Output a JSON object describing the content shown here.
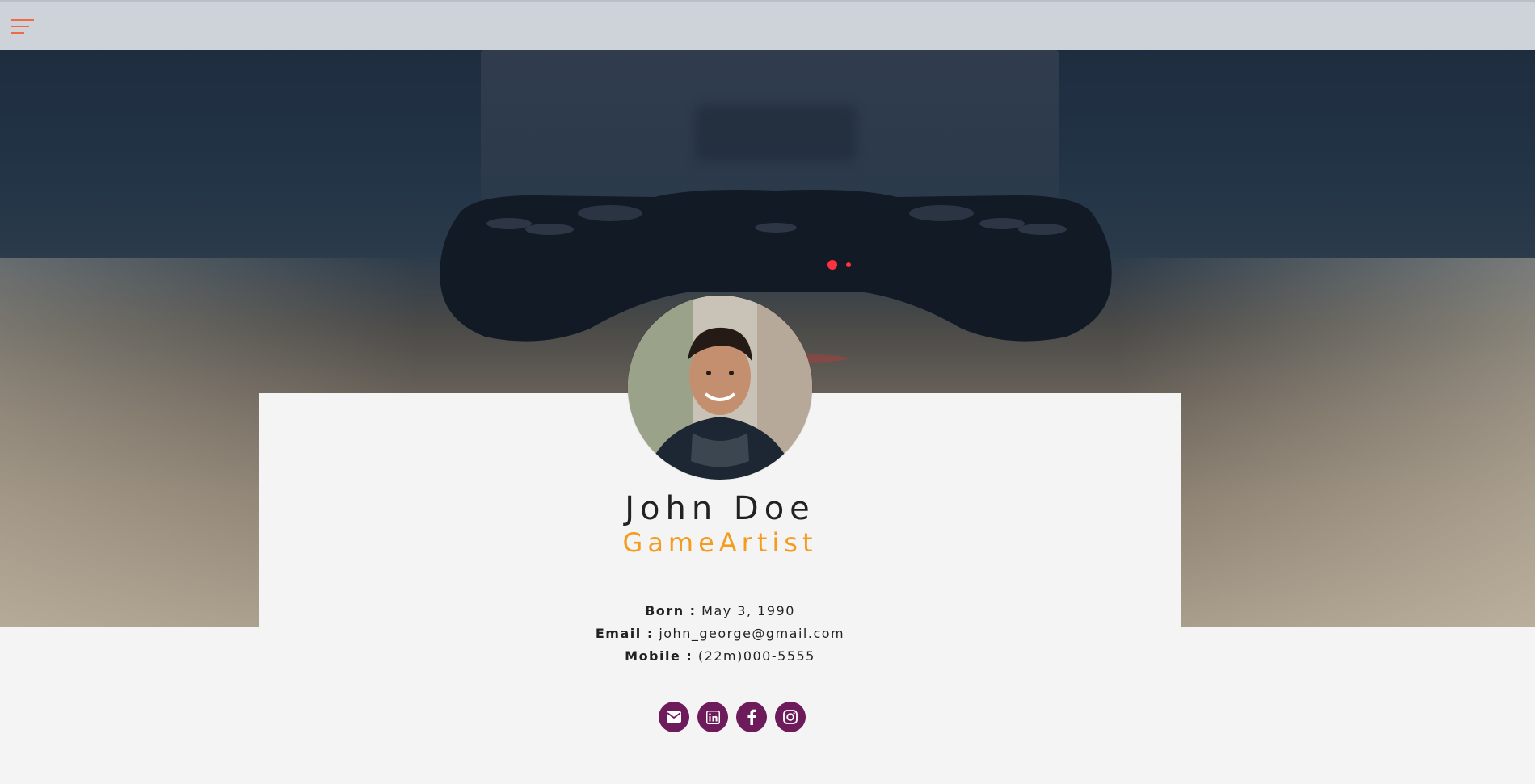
{
  "navbar": {
    "menu_icon": "hamburger-menu-icon",
    "menu_icon_color": "#f06a4a"
  },
  "profile": {
    "name": "John Doe",
    "title": "GameArtist",
    "details": [
      {
        "label": "Born :",
        "value": "May 3, 1990"
      },
      {
        "label": "Email :",
        "value": "john_george@gmail.com"
      },
      {
        "label": "Mobile :",
        "value": "(22m)000-5555"
      }
    ]
  },
  "socials": [
    {
      "icon": "envelope-icon",
      "service": "email"
    },
    {
      "icon": "linkedin-icon",
      "service": "linkedin"
    },
    {
      "icon": "facebook-icon",
      "service": "facebook"
    },
    {
      "icon": "instagram-icon",
      "service": "instagram"
    }
  ],
  "colors": {
    "accent": "#f39c1f",
    "social_bg": "#6d1b5b",
    "card_bg": "#f4f4f4",
    "text": "#222222"
  }
}
